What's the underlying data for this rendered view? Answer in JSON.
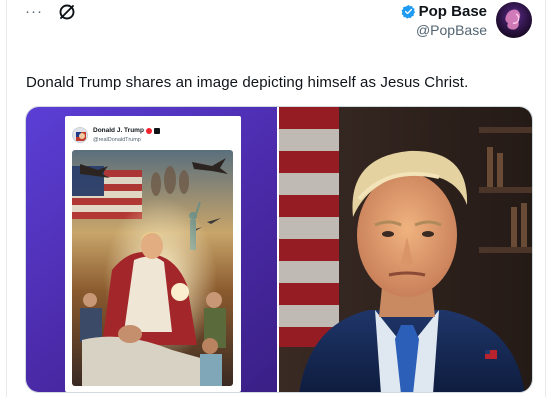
{
  "header": {
    "more_icon": "more-horizontal-icon",
    "mute_icon": "mute-icon",
    "more_glyph": "···"
  },
  "author": {
    "display_name": "Pop Base",
    "handle": "@PopBase",
    "verified_icon": "verified-badge-icon",
    "verified_color": "#1d9bf0"
  },
  "tweet": {
    "text": "Donald Trump shares an image depicting himself as Jesus Christ."
  },
  "media": {
    "left_image": {
      "embedded_post": {
        "display_name": "Donald J. Trump",
        "handle": "@realDonaldTrump"
      },
      "gradient_colors": [
        "#5b3fd6",
        "#3a1f86"
      ]
    },
    "right_image": {}
  },
  "colors": {
    "text_primary": "#0f1419",
    "text_secondary": "#536471",
    "border": "#cfd9de"
  }
}
